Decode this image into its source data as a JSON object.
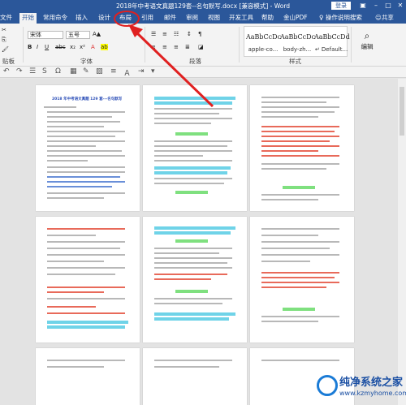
{
  "window": {
    "title": "2018年中考语文真题129套--名句默写.docx [兼容模式] - Word",
    "login": "登录"
  },
  "tabs": [
    "文件",
    "开始",
    "常用命令",
    "插入",
    "设计",
    "布局",
    "引用",
    "邮件",
    "审阅",
    "视图",
    "开发工具",
    "帮助",
    "金山PDF"
  ],
  "active_tab": "开始",
  "tell_me": "操作说明搜索",
  "share": "共享",
  "ribbon": {
    "font_name": "宋体",
    "font_size": "五号",
    "group_font": "字体",
    "group_paragraph": "段落",
    "group_styles": "样式",
    "group_clipboard": "贴板",
    "edit": "编辑",
    "styles": [
      {
        "preview": "AaBbCcDc",
        "name": "apple-co..."
      },
      {
        "preview": "AaBbCcDc",
        "name": "body-zh..."
      },
      {
        "preview": "AaBbCcDd",
        "name": "↵ Default..."
      }
    ]
  },
  "page_title": "2018 年中考语文真题 129 套---名句默写",
  "watermark": {
    "line1": "纯净系统之家",
    "line2": "www.kzmyhome.com"
  },
  "colors": {
    "word_blue": "#2b579a",
    "annotation_red": "#e02020"
  }
}
